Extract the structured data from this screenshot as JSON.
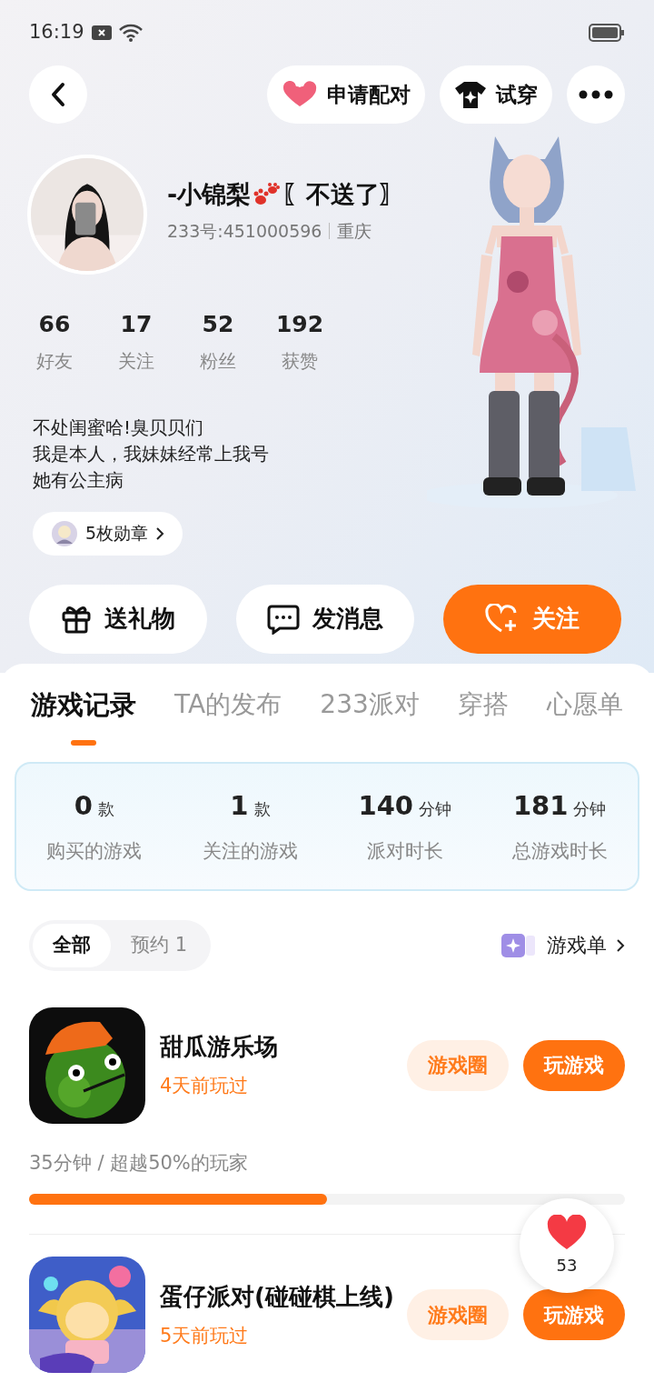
{
  "status_bar": {
    "time": "16:19"
  },
  "top_actions": [
    {
      "label": "申请配对",
      "kind": "match"
    },
    {
      "label": "试穿",
      "kind": "tryon"
    }
  ],
  "profile": {
    "name": "-小锦梨",
    "name_suffix": "〖不送了〗",
    "id": "233号:451000596",
    "location": "重庆"
  },
  "stats": [
    {
      "value": "66",
      "label": "好友"
    },
    {
      "value": "17",
      "label": "关注"
    },
    {
      "value": "52",
      "label": "粉丝"
    },
    {
      "value": "192",
      "label": "获赞"
    }
  ],
  "bio": [
    "不处闺蜜哈!臭贝贝们",
    "我是本人，我妹妹经常上我号",
    "她有公主病"
  ],
  "badges": {
    "label": "5枚勋章"
  },
  "actions": [
    {
      "label": "送礼物",
      "kind": "gift"
    },
    {
      "label": "发消息",
      "kind": "message"
    },
    {
      "label": "关注",
      "kind": "follow"
    }
  ],
  "tabs": [
    {
      "label": "游戏记录",
      "selected": true
    },
    {
      "label": "TA的发布",
      "selected": false
    },
    {
      "label": "233派对",
      "selected": false
    },
    {
      "label": "穿搭",
      "selected": false
    },
    {
      "label": "心愿单",
      "selected": false
    }
  ],
  "summary": [
    {
      "value": "0",
      "unit": "款",
      "label": "购买的游戏"
    },
    {
      "value": "1",
      "unit": "款",
      "label": "关注的游戏"
    },
    {
      "value": "140",
      "unit": "分钟",
      "label": "派对时长"
    },
    {
      "value": "181",
      "unit": "分钟",
      "label": "总游戏时长"
    }
  ],
  "filters": [
    {
      "label": "全部",
      "selected": true
    },
    {
      "label": "预约 1",
      "selected": false
    }
  ],
  "game_list_link": "游戏单",
  "games": [
    {
      "title": "甜瓜游乐场",
      "last_played": "4天前玩过",
      "circle_button": "游戏圈",
      "play_button": "玩游戏",
      "stat": "35分钟 / 超越50%的玩家",
      "level": 0.5
    },
    {
      "title": "蛋仔派对(碰碰棋上线)",
      "last_played": "5天前玩过",
      "circle_button": "游戏圈",
      "play_button": "玩游戏"
    }
  ],
  "likes": {
    "count": "53"
  }
}
